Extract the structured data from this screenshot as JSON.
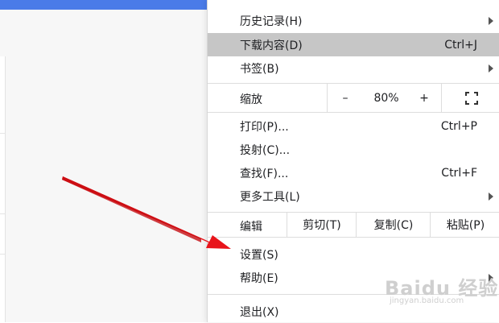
{
  "menu": {
    "history": {
      "label": "历史记录(H)"
    },
    "downloads": {
      "label": "下载内容(D)",
      "shortcut": "Ctrl+J"
    },
    "bookmarks": {
      "label": "书签(B)"
    },
    "zoom": {
      "label": "缩放",
      "minus": "–",
      "value": "80%",
      "plus": "+"
    },
    "print": {
      "label": "打印(P)...",
      "shortcut": "Ctrl+P"
    },
    "cast": {
      "label": "投射(C)..."
    },
    "find": {
      "label": "查找(F)...",
      "shortcut": "Ctrl+F"
    },
    "more_tools": {
      "label": "更多工具(L)"
    },
    "edit": {
      "label": "编辑",
      "cut": "剪切(T)",
      "copy": "复制(C)",
      "paste": "粘贴(P)"
    },
    "settings": {
      "label": "设置(S)"
    },
    "help": {
      "label": "帮助(E)"
    },
    "exit": {
      "label": "退出(X)"
    }
  },
  "watermark": {
    "main": "Baidu 经验",
    "sub": "jingyan.baidu.com"
  },
  "colors": {
    "highlight": "#c6c6c6",
    "arrow": "#e8141b",
    "topbar": "#4a7be8"
  }
}
